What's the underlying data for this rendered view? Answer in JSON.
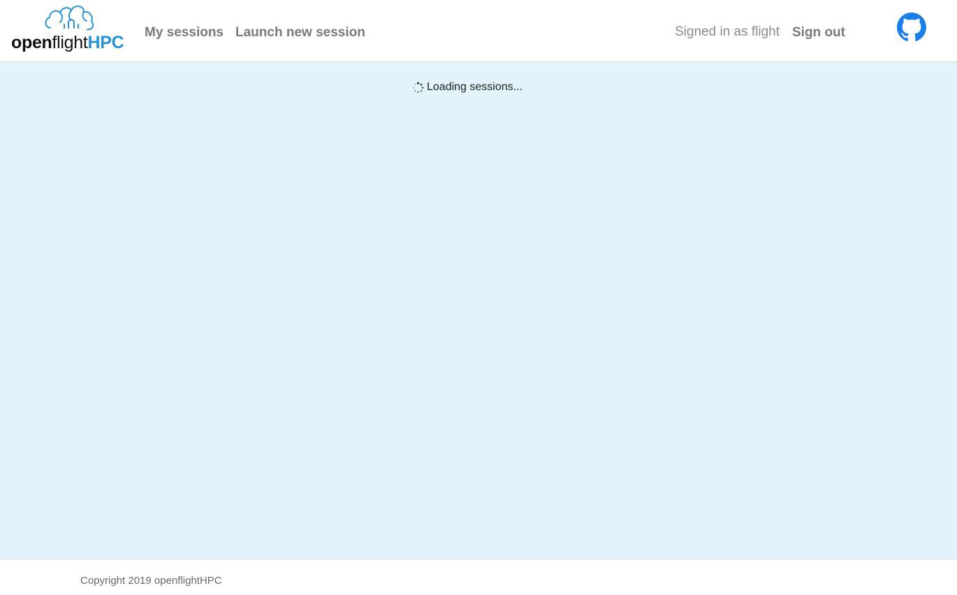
{
  "brand": {
    "part1": "open",
    "part2": "flight",
    "part3": "HPC",
    "icon": "cloud-icon",
    "accent_color": "#2793d6"
  },
  "nav": {
    "my_sessions": "My sessions",
    "launch_new_session": "Launch new session"
  },
  "user": {
    "signed_in_text": "Signed in as flight",
    "sign_out": "Sign out"
  },
  "github": {
    "icon": "github-icon",
    "color": "#1a7fe8"
  },
  "main": {
    "loading_text": "Loading sessions...",
    "spinner_icon": "spinner-icon",
    "background": "#e2f3fb"
  },
  "footer": {
    "copyright": "Copyright 2019 openflightHPC"
  }
}
